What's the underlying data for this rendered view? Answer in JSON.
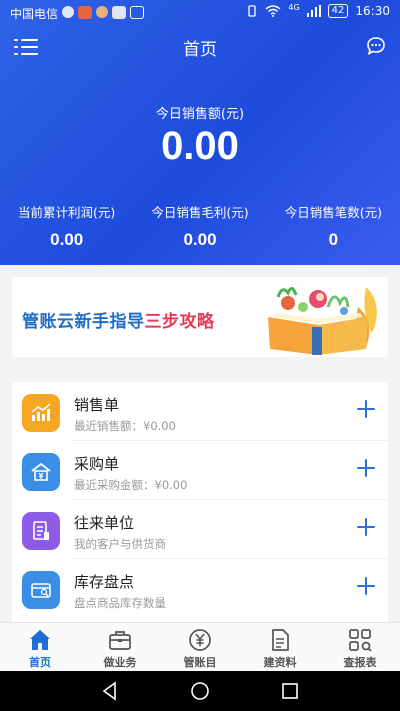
{
  "status_bar": {
    "carrier": "中国电信",
    "network": "4G",
    "battery": "42",
    "time": "16:30"
  },
  "header": {
    "title": "首页",
    "menu_icon": "menu-icon",
    "message_icon": "chat-bubble-icon"
  },
  "summary": {
    "today_sales_label": "今日销售额(元)",
    "today_sales_value": "0.00",
    "stats": [
      {
        "label": "当前累计利润(元)",
        "value": "0.00"
      },
      {
        "label": "今日销售毛利(元)",
        "value": "0.00"
      },
      {
        "label": "今日销售笔数(元)",
        "value": "0"
      }
    ]
  },
  "banner": {
    "text_main": "管账云新手指导",
    "text_highlight": "三步攻略"
  },
  "actions": [
    {
      "title": "销售单",
      "subtitle": "最近销售额：¥0.00",
      "icon": "sales-chart-icon",
      "color": "#f5a623"
    },
    {
      "title": "采购单",
      "subtitle": "最近采购金额：¥0.00",
      "icon": "purchase-yuan-icon",
      "color": "#3a8ee6"
    },
    {
      "title": "往来单位",
      "subtitle": "我的客户与供货商",
      "icon": "partners-document-icon",
      "color": "#8e5be6"
    },
    {
      "title": "库存盘点",
      "subtitle": "盘点商品库存数量",
      "icon": "inventory-box-icon",
      "color": "#3a8ee6"
    }
  ],
  "tabs": [
    {
      "label": "首页",
      "icon": "home-icon",
      "active": true
    },
    {
      "label": "做业务",
      "icon": "briefcase-icon",
      "active": false
    },
    {
      "label": "管账目",
      "icon": "yuan-circle-icon",
      "active": false
    },
    {
      "label": "建资料",
      "icon": "document-icon",
      "active": false
    },
    {
      "label": "查报表",
      "icon": "grid-report-icon",
      "active": false
    }
  ],
  "colors": {
    "hero_blue": "#2a58e2",
    "accent_blue": "#1f6ed4",
    "highlight_red": "#e63a55"
  }
}
